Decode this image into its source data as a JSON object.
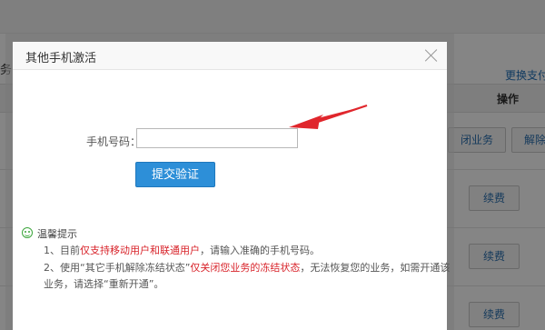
{
  "background": {
    "left_label": "务",
    "switch_link": "更换支付",
    "table_header": "操作",
    "buttons": {
      "close_service": "闭业务",
      "unfreeze": "解除",
      "renew": "续费"
    }
  },
  "dialog": {
    "title": "其他手机激活",
    "phone_label": "手机号码：",
    "phone_value": "",
    "submit_label": "提交验证",
    "tips": {
      "heading": "温馨提示",
      "line1_prefix": "1、目前",
      "line1_highlight": "仅支持移动用户和联通用户",
      "line1_suffix": "，请输入准确的手机号码。",
      "line2_prefix": "2、使用“其它手机解除冻结状态”",
      "line2_highlight": "仅关闭您业务的冻结状态",
      "line2_suffix": "，无法恢复您的业务，如需开通该",
      "line3": "业务，请选择“重新开通”。"
    }
  },
  "colors": {
    "accent_blue": "#2d8fd8",
    "highlight_red": "#d8232a",
    "arrow_red": "#e0262c",
    "tips_green": "#3aa53a"
  }
}
